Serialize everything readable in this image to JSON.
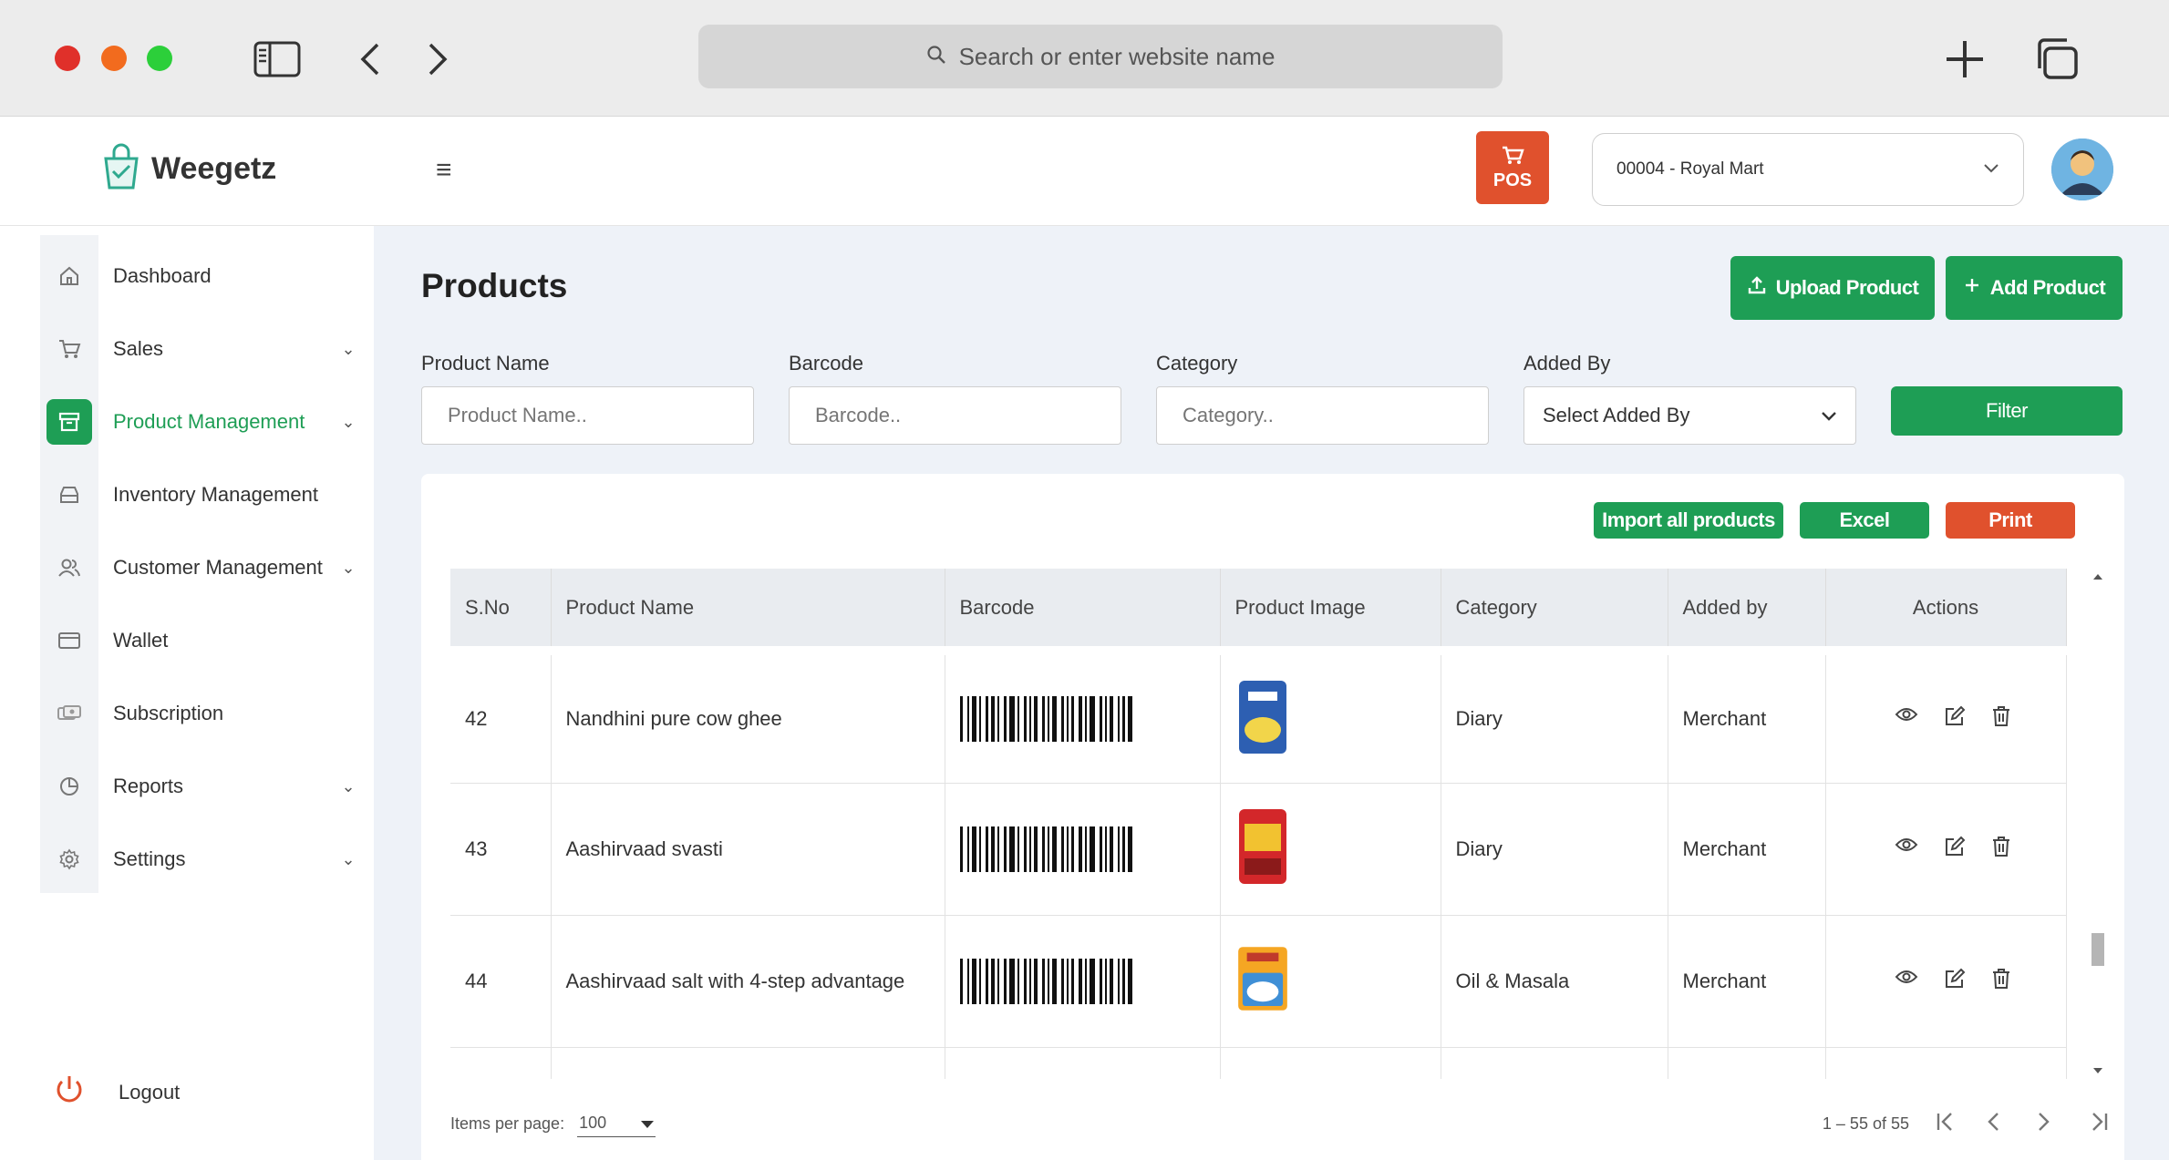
{
  "browser": {
    "address_placeholder": "Search or enter website name"
  },
  "header": {
    "logo_text": "Weegetz",
    "pos_label": "POS",
    "store": "00004 - Royal Mart"
  },
  "sidebar": {
    "items": [
      {
        "label": "Dashboard",
        "icon": "home-icon"
      },
      {
        "label": "Sales",
        "icon": "cart-icon",
        "chevron": true
      },
      {
        "label": "Product Management",
        "icon": "box-icon",
        "chevron": true,
        "active": true
      },
      {
        "label": "Inventory Management",
        "icon": "inventory-icon"
      },
      {
        "label": "Customer Management",
        "icon": "users-icon",
        "chevron": true
      },
      {
        "label": "Wallet",
        "icon": "wallet-icon"
      },
      {
        "label": "Subscription",
        "icon": "subscription-icon"
      },
      {
        "label": "Reports",
        "icon": "reports-icon",
        "chevron": true
      },
      {
        "label": "Settings",
        "icon": "gear-icon",
        "chevron": true
      }
    ],
    "logout": "Logout"
  },
  "main": {
    "title": "Products",
    "upload_button": "Upload Product",
    "add_button": "Add Product",
    "filters": {
      "product_name_label": "Product Name",
      "product_name_placeholder": "Product Name..",
      "barcode_label": "Barcode",
      "barcode_placeholder": "Barcode..",
      "category_label": "Category",
      "category_placeholder": "Category..",
      "added_by_label": "Added By",
      "added_by_value": "Select Added By",
      "filter_button": "Filter"
    },
    "actions": {
      "import": "Import all products",
      "excel": "Excel",
      "print": "Print"
    },
    "table": {
      "columns": [
        "S.No",
        "Product Name",
        "Barcode",
        "Product Image",
        "Category",
        "Added by",
        "Actions"
      ],
      "rows": [
        {
          "sno": "42",
          "name": "Nandhini pure cow ghee",
          "category": "Diary",
          "added_by": "Merchant"
        },
        {
          "sno": "43",
          "name": "Aashirvaad svasti",
          "category": "Diary",
          "added_by": "Merchant"
        },
        {
          "sno": "44",
          "name": "Aashirvaad salt with 4-step advantage",
          "category": "Oil & Masala",
          "added_by": "Merchant"
        }
      ]
    },
    "pager": {
      "items_label": "Items per page:",
      "items_value": "100",
      "range": "1 – 55 of 55"
    }
  },
  "colors": {
    "green": "#1e9e55",
    "red": "#e0512d"
  }
}
